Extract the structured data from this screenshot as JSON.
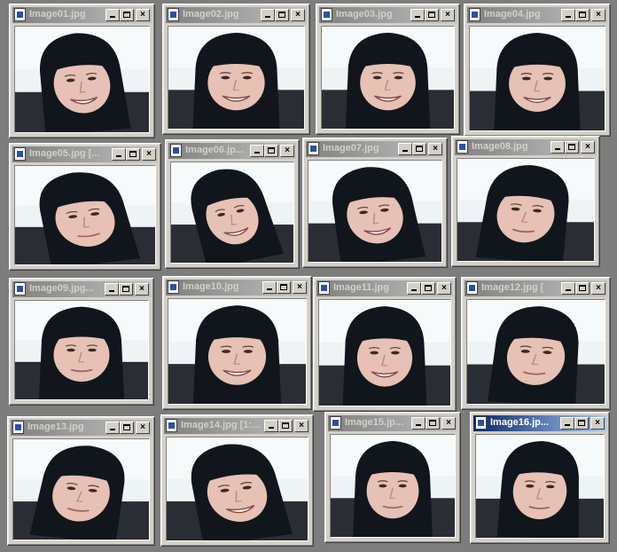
{
  "windows": [
    {
      "title": "Image01.jpg",
      "active": false
    },
    {
      "title": "Image02.jpg",
      "active": false
    },
    {
      "title": "Image03.jpg",
      "active": false
    },
    {
      "title": "Image04.jpg",
      "active": false
    },
    {
      "title": "Image05.jpg [...",
      "active": false
    },
    {
      "title": "Image06.jp...",
      "active": false
    },
    {
      "title": "Image07.jpg",
      "active": false
    },
    {
      "title": "Image08.jpg",
      "active": false
    },
    {
      "title": "Image09.jpg...",
      "active": false
    },
    {
      "title": "Image10.jpg",
      "active": false
    },
    {
      "title": "Image11.jpg",
      "active": false
    },
    {
      "title": "Image12.jpg [",
      "active": false
    },
    {
      "title": "Image13.jpg",
      "active": false
    },
    {
      "title": "Image14.jpg [1:...",
      "active": false
    },
    {
      "title": "Image15.jp...",
      "active": false
    },
    {
      "title": "Image16.jp...",
      "active": true
    }
  ],
  "title_buttons": {
    "close": "×"
  },
  "colors": {
    "desktop": "#7d7d7d",
    "window_face": "#d4d0c8",
    "inactive_title": "#808080",
    "active_title": "#0a246a",
    "hair": "#101820",
    "skin": "#e8c2b6"
  },
  "icons": {
    "title_icon": "image-file-icon",
    "minimize": "minimize-icon",
    "maximize": "maximize-icon",
    "close": "close-icon"
  }
}
